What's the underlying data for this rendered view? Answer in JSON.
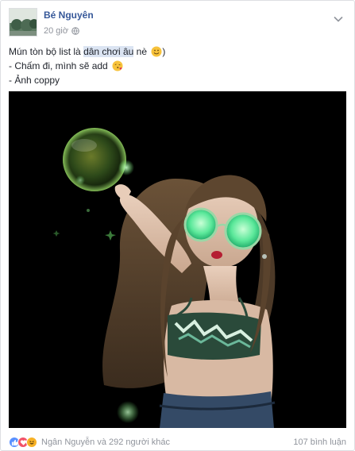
{
  "post": {
    "author": "Bé Nguyên",
    "time": "20 giờ",
    "text_prefix": "Mún tòn bộ list là ",
    "text_highlight": "dân chơi âu",
    "text_suffix": " nè",
    "text_close": ")",
    "line2": "- Chấm đi, mình sẽ add",
    "line3": "- Ảnh coppy"
  },
  "footer": {
    "reactions_names": "Ngân Nguyễn và 292 người khác",
    "comments_count": "107 bình luận",
    "reaction_icons": [
      "like-icon",
      "love-icon",
      "haha-icon"
    ]
  },
  "colors": {
    "link": "#365899",
    "muted": "#90949c",
    "like": "#5890ff",
    "love": "#f25268",
    "haha": "#f7b125"
  }
}
